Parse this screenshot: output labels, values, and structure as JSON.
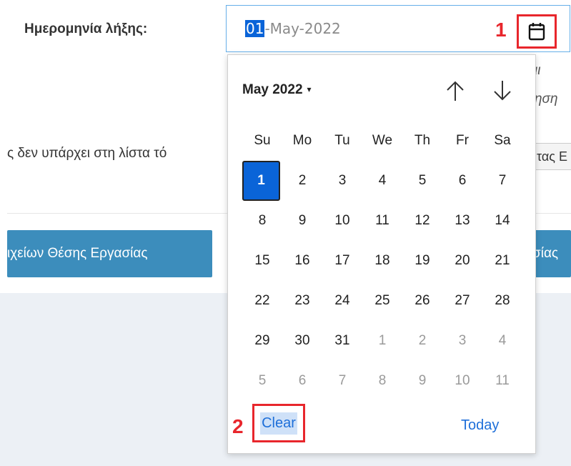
{
  "form": {
    "expiry_label": "Ημερομηνία λήξης:",
    "date_value_selected": "01",
    "date_value_rest": "-May-2022",
    "background_text_middle": "ς δεν υπάρχει στη λίστα τό",
    "right_fragment_1": "ιι",
    "right_fragment_2": "ηση",
    "right_fragment_3": "τας Ε",
    "button_left_label": "ιχείων Θέσης Εργασίας",
    "button_right_label": "σίας"
  },
  "markers": {
    "m1": "1",
    "m2": "2"
  },
  "picker": {
    "month_label": "May 2022",
    "caret": "▾",
    "weekdays": [
      "Su",
      "Mo",
      "Tu",
      "We",
      "Th",
      "Fr",
      "Sa"
    ],
    "weeks": [
      [
        {
          "d": "1",
          "s": "selected"
        },
        {
          "d": "2"
        },
        {
          "d": "3"
        },
        {
          "d": "4"
        },
        {
          "d": "5"
        },
        {
          "d": "6"
        },
        {
          "d": "7"
        }
      ],
      [
        {
          "d": "8"
        },
        {
          "d": "9"
        },
        {
          "d": "10"
        },
        {
          "d": "11"
        },
        {
          "d": "12"
        },
        {
          "d": "13"
        },
        {
          "d": "14"
        }
      ],
      [
        {
          "d": "15"
        },
        {
          "d": "16"
        },
        {
          "d": "17"
        },
        {
          "d": "18"
        },
        {
          "d": "19"
        },
        {
          "d": "20"
        },
        {
          "d": "21"
        }
      ],
      [
        {
          "d": "22"
        },
        {
          "d": "23"
        },
        {
          "d": "24"
        },
        {
          "d": "25"
        },
        {
          "d": "26"
        },
        {
          "d": "27"
        },
        {
          "d": "28"
        }
      ],
      [
        {
          "d": "29"
        },
        {
          "d": "30"
        },
        {
          "d": "31"
        },
        {
          "d": "1",
          "s": "muted"
        },
        {
          "d": "2",
          "s": "muted"
        },
        {
          "d": "3",
          "s": "muted"
        },
        {
          "d": "4",
          "s": "muted"
        }
      ],
      [
        {
          "d": "5",
          "s": "muted"
        },
        {
          "d": "6",
          "s": "muted"
        },
        {
          "d": "7",
          "s": "muted"
        },
        {
          "d": "8",
          "s": "muted"
        },
        {
          "d": "9",
          "s": "muted"
        },
        {
          "d": "10",
          "s": "muted"
        },
        {
          "d": "11",
          "s": "muted"
        }
      ]
    ],
    "clear_label": "Clear",
    "today_label": "Today"
  },
  "icons": {
    "calendar": "calendar-icon",
    "arrow_up": "arrow-up-icon",
    "arrow_down": "arrow-down-icon"
  },
  "colors": {
    "accent": "#0a64d8",
    "annotation_red": "#e8262c",
    "button_blue": "#3c8dbc",
    "link_blue": "#1e6fd9"
  }
}
